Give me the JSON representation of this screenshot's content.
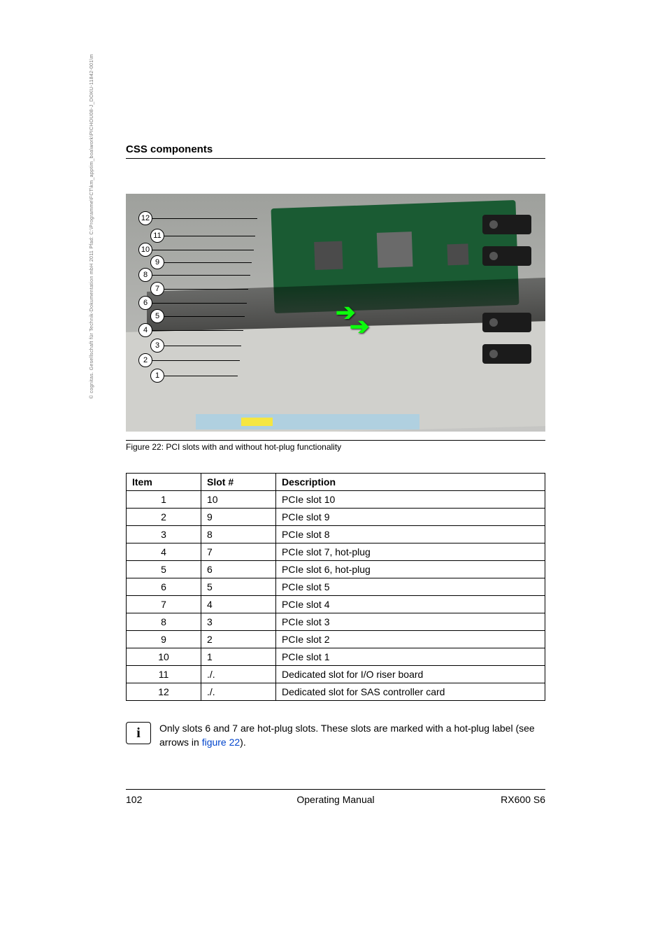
{
  "header": {
    "section_title": "CSS components"
  },
  "side_note": "© cognitas. Gesellschaft für Technik-Dokumentation mbH 2011     Pfad: C:\\Programme\\FCT\\km_apptim_boa\\work\\PICHOU08-J_DOKU-11842-001\\m",
  "figure": {
    "caption": "Figure 22: PCI slots with and without hot-plug functionality",
    "callouts": [
      "12",
      "11",
      "10",
      "9",
      "8",
      "7",
      "6",
      "5",
      "4",
      "3",
      "2",
      "1"
    ]
  },
  "table": {
    "headers": {
      "item": "Item",
      "slot": "Slot #",
      "desc": "Description"
    },
    "rows": [
      {
        "item": "1",
        "slot": "10",
        "desc": "PCIe slot 10"
      },
      {
        "item": "2",
        "slot": "9",
        "desc": "PCIe slot 9"
      },
      {
        "item": "3",
        "slot": "8",
        "desc": "PCIe slot 8"
      },
      {
        "item": "4",
        "slot": "7",
        "desc": "PCIe slot 7, hot-plug"
      },
      {
        "item": "5",
        "slot": "6",
        "desc": "PCIe slot 6, hot-plug"
      },
      {
        "item": "6",
        "slot": "5",
        "desc": "PCIe slot 5"
      },
      {
        "item": "7",
        "slot": "4",
        "desc": "PCIe slot 4"
      },
      {
        "item": "8",
        "slot": "3",
        "desc": "PCIe slot 3"
      },
      {
        "item": "9",
        "slot": "2",
        "desc": "PCIe slot 2"
      },
      {
        "item": "10",
        "slot": "1",
        "desc": "PCIe slot 1"
      },
      {
        "item": "11",
        "slot": "./.",
        "desc": "Dedicated slot for I/O riser board"
      },
      {
        "item": "12",
        "slot": "./.",
        "desc": "Dedicated slot for SAS controller card"
      }
    ]
  },
  "info": {
    "text_before": "Only slots 6 and 7 are hot-plug slots. These slots are marked with a hot-plug label (see arrows in ",
    "link_text": "figure 22",
    "text_after": ")."
  },
  "footer": {
    "page": "102",
    "center": "Operating Manual",
    "right": "RX600 S6"
  }
}
